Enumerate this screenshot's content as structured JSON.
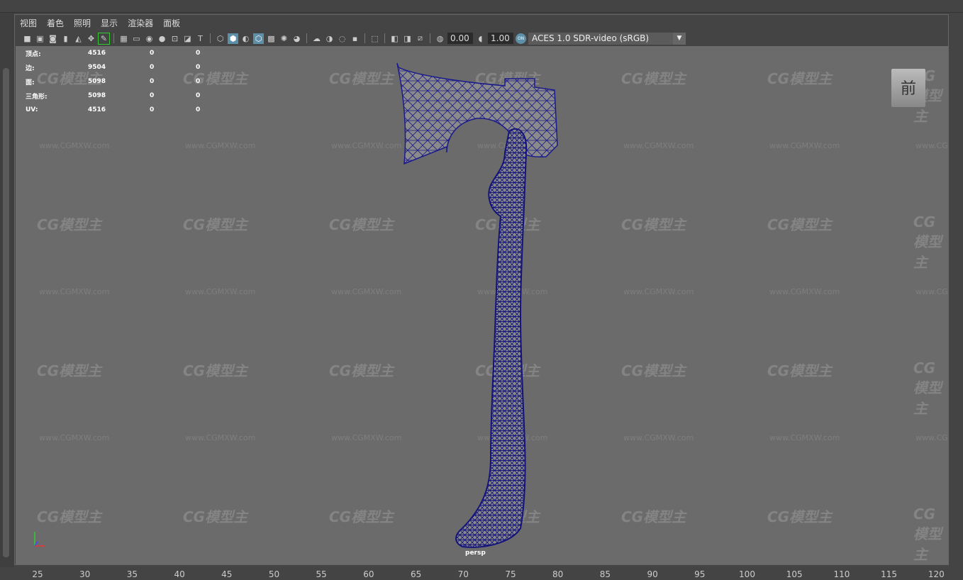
{
  "menu": [
    "视图",
    "着色",
    "照明",
    "显示",
    "渲染器",
    "面板"
  ],
  "toolbar": {
    "exposure": "0.00",
    "gamma": "1.00",
    "color_space": "ACES 1.0 SDR-video (sRGB)",
    "cm_badge": "ON"
  },
  "hud": {
    "rows": [
      {
        "label": "顶点:",
        "v1": "4516",
        "v2": "0",
        "v3": "0"
      },
      {
        "label": "边:",
        "v1": "9504",
        "v2": "0",
        "v3": "0"
      },
      {
        "label": "面:",
        "v1": "5098",
        "v2": "0",
        "v3": "0"
      },
      {
        "label": "三角形:",
        "v1": "5098",
        "v2": "0",
        "v3": "0"
      },
      {
        "label": "UV:",
        "v1": "4516",
        "v2": "0",
        "v3": "0"
      }
    ]
  },
  "view_cube": "前",
  "camera": "persp",
  "watermark": {
    "logo": "CG模型主",
    "url": "www.CGMXW.com"
  },
  "timeline": [
    "25",
    "30",
    "35",
    "40",
    "45",
    "50",
    "55",
    "60",
    "65",
    "70",
    "75",
    "80",
    "85",
    "90",
    "95",
    "100",
    "105",
    "110",
    "115",
    "120"
  ],
  "colors": {
    "viewport": "#6b6b6b",
    "wire": "#1a1a8c",
    "accent": "#5d90a8"
  }
}
